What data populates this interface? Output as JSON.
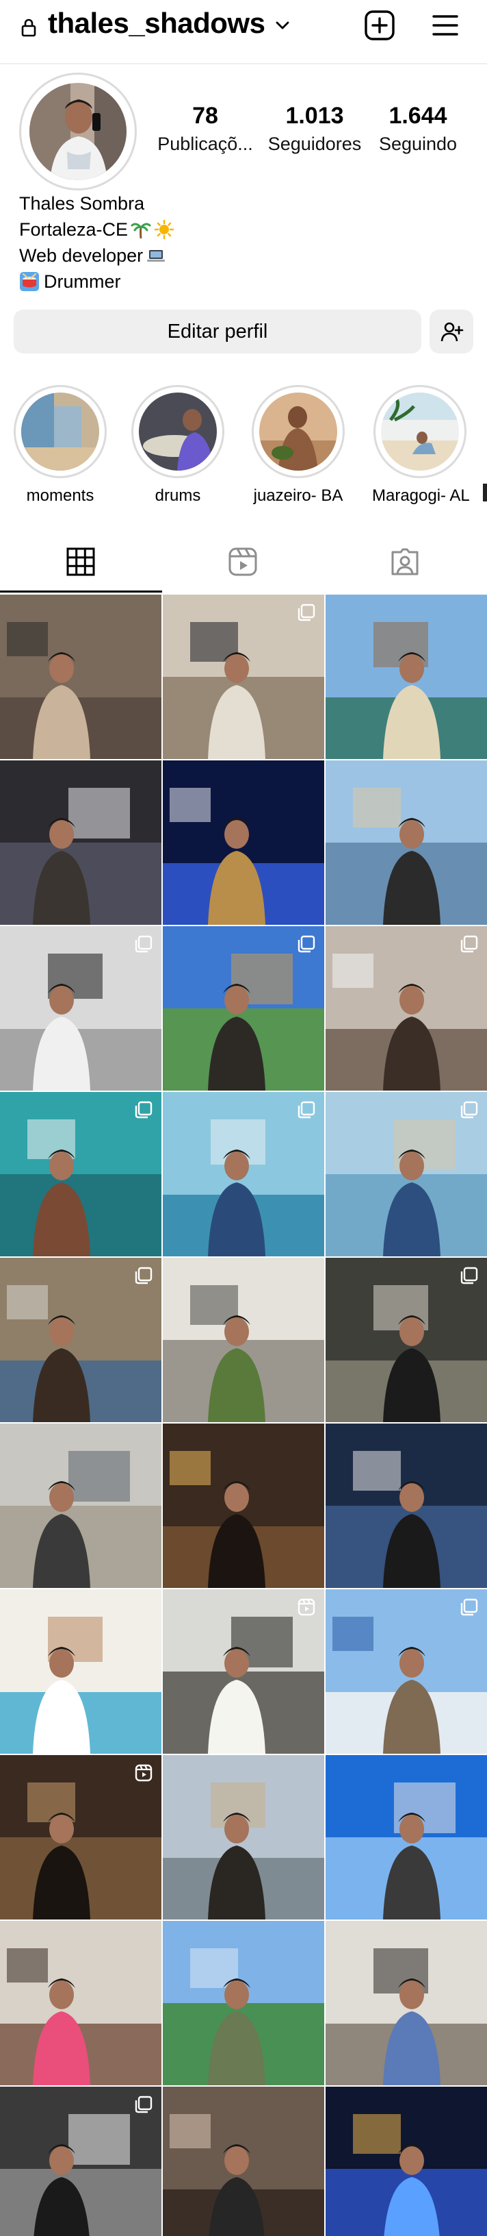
{
  "header": {
    "username": "thales_shadows",
    "icons": {
      "lock": "lock-icon",
      "chevron": "chevron-down-icon",
      "new_post": "plus-square-icon",
      "menu": "hamburger-menu-icon"
    }
  },
  "profile": {
    "stats": [
      {
        "value": "78",
        "label": "Publicaçõ..."
      },
      {
        "value": "1.013",
        "label": "Seguidores"
      },
      {
        "value": "1.644",
        "label": "Seguindo"
      }
    ],
    "name": "Thales Sombra",
    "bio_lines": [
      "Fortaleza-CE",
      "Web developer",
      "Drummer"
    ]
  },
  "actions": {
    "edit_profile": "Editar perfil",
    "add_user_icon": "add-person-icon"
  },
  "highlights": [
    {
      "label": "moments"
    },
    {
      "label": "drums"
    },
    {
      "label": "juazeiro- BA"
    },
    {
      "label": "Maragogi- AL"
    }
  ],
  "tabs": [
    {
      "icon": "grid-icon",
      "active": true
    },
    {
      "icon": "reels-icon",
      "active": false
    },
    {
      "icon": "tagged-icon",
      "active": false
    }
  ],
  "grid": {
    "columns": 3,
    "posts": [
      {
        "scene": "wanted-wall",
        "indicator": "none"
      },
      {
        "scene": "suit-indoor",
        "indicator": "multiple"
      },
      {
        "scene": "bridge-sea",
        "indicator": "none"
      },
      {
        "scene": "night-bar",
        "indicator": "none"
      },
      {
        "scene": "drums-stage",
        "indicator": "none"
      },
      {
        "scene": "beach-rocks",
        "indicator": "none"
      },
      {
        "scene": "bw-portrait",
        "indicator": "multiple"
      },
      {
        "scene": "buggy-palms",
        "indicator": "multiple"
      },
      {
        "scene": "group-selfie",
        "indicator": "multiple"
      },
      {
        "scene": "boat-water",
        "indicator": "multiple"
      },
      {
        "scene": "sea-arms",
        "indicator": "multiple"
      },
      {
        "scene": "sea-shirtless",
        "indicator": "multiple"
      },
      {
        "scene": "cafe-phone",
        "indicator": "multiple"
      },
      {
        "scene": "balcony",
        "indicator": "none"
      },
      {
        "scene": "guitar-room",
        "indicator": "multiple"
      },
      {
        "scene": "sand-beach",
        "indicator": "none"
      },
      {
        "scene": "pub-lamp",
        "indicator": "none"
      },
      {
        "scene": "night-group",
        "indicator": "none"
      },
      {
        "scene": "pool-sitting",
        "indicator": "none"
      },
      {
        "scene": "band-gig",
        "indicator": "reel"
      },
      {
        "scene": "railing-sea",
        "indicator": "multiple"
      },
      {
        "scene": "guitar-dark",
        "indicator": "reel"
      },
      {
        "scene": "bridge-sit",
        "indicator": "none"
      },
      {
        "scene": "monument-sky",
        "indicator": "none"
      },
      {
        "scene": "family-selfie",
        "indicator": "none"
      },
      {
        "scene": "palms-lawn",
        "indicator": "none"
      },
      {
        "scene": "group-indoor",
        "indicator": "none"
      },
      {
        "scene": "drums-movavi",
        "indicator": "multiple"
      },
      {
        "scene": "friends-selfie",
        "indicator": "none"
      },
      {
        "scene": "pool-night",
        "indicator": "none"
      }
    ]
  },
  "colors": {
    "accent": "#000000",
    "button_bg": "#efefef",
    "ring": "#dbdbdb",
    "separator": "#efefef"
  }
}
